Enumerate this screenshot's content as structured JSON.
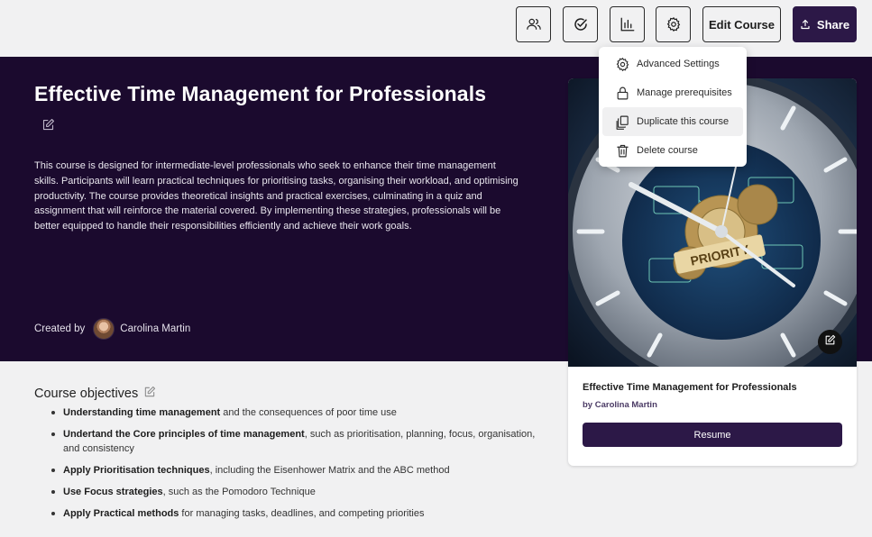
{
  "toolbar": {
    "icons": [
      "users-icon",
      "check-circle-icon",
      "bar-chart-icon",
      "gear-icon",
      "upload-icon"
    ],
    "edit_label": "Edit Course",
    "share_label": "Share"
  },
  "course": {
    "title": "Effective Time Management for Professionals",
    "description": "This course is designed for intermediate-level professionals who seek to enhance their time management skills. Participants will learn practical techniques for prioritising tasks, organising their workload, and optimising productivity. The course provides theoretical insights and practical exercises, culminating in a quiz and assignment that will reinforce the material covered. By implementing these strategies, professionals will be better equipped to handle their responsibilities efficiently and achieve their work goals.",
    "created_by_label": "Created by",
    "author": "Carolina Martin"
  },
  "menu": {
    "items": [
      {
        "label": "Advanced Settings",
        "icon": "advanced-settings-icon"
      },
      {
        "label": "Manage prerequisites",
        "icon": "lock-icon"
      },
      {
        "label": "Duplicate this course",
        "icon": "duplicate-icon"
      },
      {
        "label": "Delete course",
        "icon": "trash-icon"
      }
    ]
  },
  "objectives": {
    "heading": "Course objectives",
    "items": [
      {
        "bold": "Understanding time management",
        "rest": " and the consequences of poor time use"
      },
      {
        "bold": "Undertand the Core principles of time management",
        "rest": ", such as prioritisation, planning, focus, organisation, and consistency"
      },
      {
        "bold": "Apply Prioritisation techniques",
        "rest": ", including the Eisenhower Matrix and the ABC method"
      },
      {
        "bold": "Use Focus strategies",
        "rest": ", such as the Pomodoro Technique"
      },
      {
        "bold": "Apply Practical methods",
        "rest": " for managing tasks, deadlines, and competing priorities"
      }
    ]
  },
  "card": {
    "title": "Effective Time Management for Professionals",
    "author": "by Carolina Martin",
    "resume_label": "Resume",
    "image_text": "PRIORITY"
  },
  "colors": {
    "brand_dark": "#2c1847",
    "hero_bg": "#1b0a2e",
    "page_bg": "#f1f1f2"
  }
}
